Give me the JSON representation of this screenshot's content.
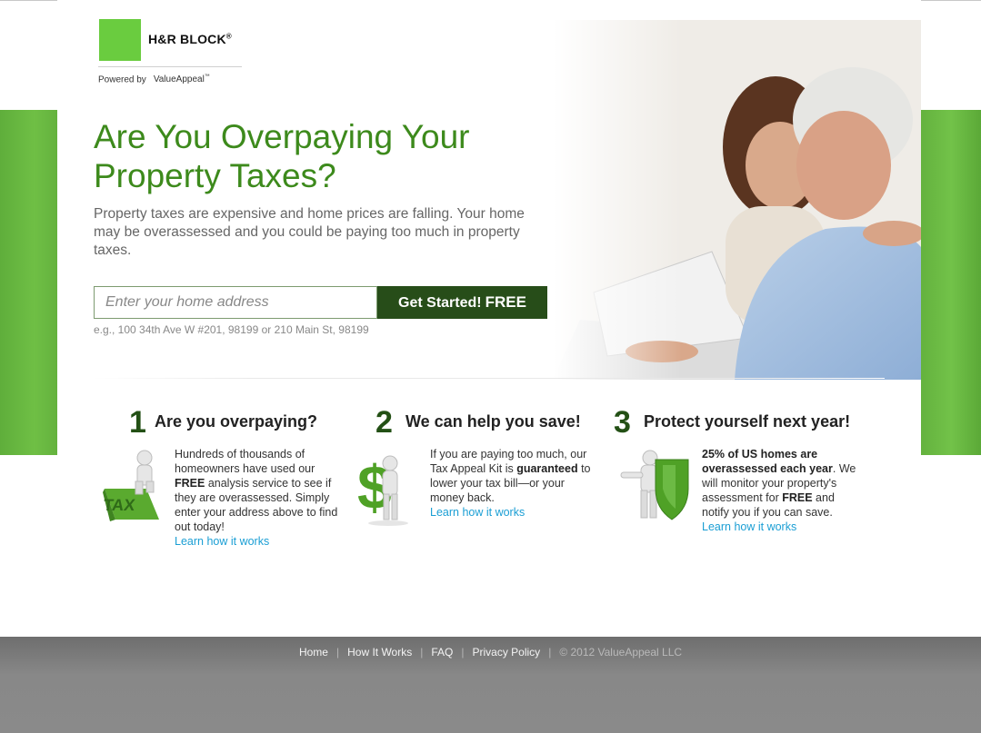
{
  "brand": {
    "logo_text": "H&R BLOCK",
    "logo_mark": "®",
    "powered_by": "Powered by",
    "partner": "ValueAppeal",
    "partner_mark": "™",
    "logo_color": "#6acc3f"
  },
  "hero": {
    "headline_line1": "Are You Overpaying Your",
    "headline_line2": "Property Taxes?",
    "intro": "Property taxes are expensive and home prices are falling. Your home may be overassessed and you could be paying too much in property taxes.",
    "address_placeholder": "Enter your home address",
    "address_value": "",
    "cta_label": "Get Started!",
    "cta_free": "FREE",
    "example_text": "e.g., 100 34th Ave W #201, 98199 or 210 Main St, 98199"
  },
  "steps": [
    {
      "number": "1",
      "title": "Are you overpaying?",
      "text_a": "Hundreds of thousands of homeowners have used our ",
      "bold_a": "FREE",
      "text_b": " analysis service to see if they are overassessed. Simply enter your address above to find out today!",
      "link": "Learn how it works",
      "icon": "tax-figure-icon"
    },
    {
      "number": "2",
      "title": "We can help you save!",
      "text_a": "If you are paying too much, our Tax Appeal Kit is ",
      "bold_a": "guaranteed",
      "text_b": " to lower your tax bill—or your money back.",
      "link": "Learn how it works",
      "icon": "dollar-figure-icon"
    },
    {
      "number": "3",
      "title": "Protect yourself next year!",
      "bold_a": "25% of US homes are overassessed each year",
      "text_a": ". We will monitor your property's assessment for ",
      "bold_b": "FREE",
      "text_b": " and notify you if you can save.",
      "link": "Learn how it works",
      "icon": "shield-figure-icon"
    }
  ],
  "footer": {
    "links": [
      "Home",
      "How It Works",
      "FAQ",
      "Privacy Policy"
    ],
    "copyright": "© 2012 ValueAppeal LLC"
  },
  "colors": {
    "headline": "#3d8a1c",
    "cta_bg": "#274d19",
    "link": "#1a9ed4",
    "band_green": "#6fbf45"
  }
}
